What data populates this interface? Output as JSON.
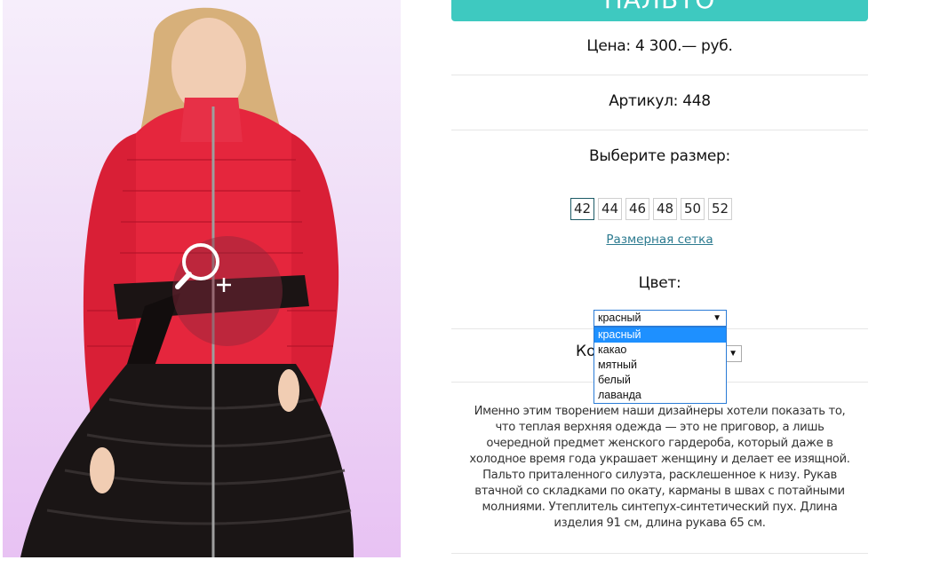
{
  "product": {
    "title": "ПАЛЬТО",
    "price": "Цена: 4 300.— руб.",
    "sku": "Артикул: 448",
    "size_heading": "Выберите размер:",
    "sizes": [
      "42",
      "44",
      "46",
      "48",
      "50",
      "52"
    ],
    "selected_size": "42",
    "size_chart_link": "Размерная сетка",
    "color_heading": "Цвет:",
    "color_select_value": "красный",
    "color_options": [
      "красный",
      "какао",
      "мятный",
      "белый",
      "лаванда"
    ],
    "highlighted_color": "красный",
    "quantity_label_visible": "Ко",
    "description": "Именно этим творением наши дизайнеры хотели показать то, что теплая верхняя одежда — это не приговор, а лишь очередной предмет женского гардероба, который даже в холодное время года украшает женщину и делает ее изящной. Пальто приталенного силуэта, расклешенное к низу. Рукав втачной со складками по окату, карманы в швах с потайными молниями. Утеплитель синтепух-синтетический пух. Длина изделия 91 см, длина рукава 65 см."
  },
  "colors": {
    "accent": "#3ec9c0",
    "link": "#2b7a8f",
    "option_highlight": "#1e90ff"
  },
  "icons": {
    "zoom": "magnifier-plus-icon",
    "select_arrow": "triangle-down-icon"
  }
}
